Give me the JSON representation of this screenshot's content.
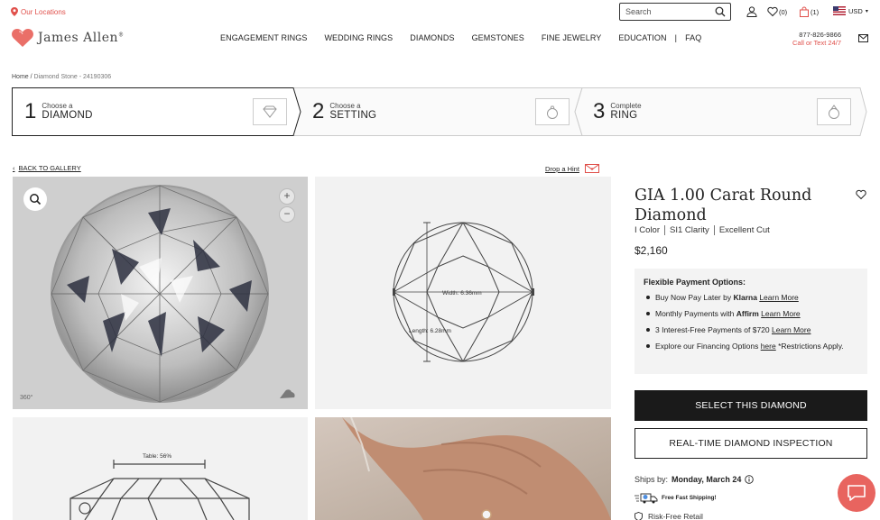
{
  "utility": {
    "location_label": "Our Locations",
    "search_placeholder": "Search",
    "wishlist_count": "(0)",
    "cart_count": "(1)",
    "currency": "USD"
  },
  "header": {
    "logo_text": "James Allen",
    "nav": [
      "ENGAGEMENT RINGS",
      "WEDDING RINGS",
      "DIAMONDS",
      "GEMSTONES",
      "FINE JEWELRY",
      "EDUCATION",
      "FAQ"
    ],
    "phone": "877-826-9866",
    "phone_sub": "Call or Text 24/7"
  },
  "breadcrumb": {
    "home": "Home",
    "current": "Diamond Stone - 24190306"
  },
  "steps": [
    {
      "num": "1",
      "small": "Choose a",
      "big": "DIAMOND",
      "icon": "diamond-icon"
    },
    {
      "num": "2",
      "small": "Choose a",
      "big": "SETTING",
      "icon": "setting-icon"
    },
    {
      "num": "3",
      "small": "Complete",
      "big": "RING",
      "icon": "ring-icon"
    }
  ],
  "gallery": {
    "back_label": "BACK TO GALLERY",
    "hint_label": "Drop a Hint",
    "width_label": "Width: 6.36mm",
    "length_label": "Length: 6.28mm",
    "table_label": "Table: 56%",
    "rotate_label": "360°"
  },
  "product": {
    "title": "GIA 1.00 Carat Round Diamond",
    "specs": [
      "I Color",
      "SI1 Clarity",
      "Excellent Cut"
    ],
    "price": "$2,160"
  },
  "payment": {
    "heading": "Flexible Payment Options:",
    "items": [
      {
        "pre": "Buy Now Pay Later by ",
        "bold": "Klarna",
        "link": "Learn More",
        "post": ""
      },
      {
        "pre": "Monthly Payments with ",
        "bold": "Affirm",
        "link": "Learn More",
        "post": ""
      },
      {
        "pre": "3 Interest-Free Payments of $720 ",
        "bold": "",
        "link": "Learn More",
        "post": ""
      },
      {
        "pre": "Explore our Financing Options ",
        "bold": "",
        "link": "here",
        "post": " *Restrictions Apply."
      }
    ]
  },
  "actions": {
    "select_label": "SELECT THIS DIAMOND",
    "inspect_label": "REAL-TIME DIAMOND INSPECTION"
  },
  "shipping": {
    "ships_by_label": "Ships by:",
    "ships_by_date": "Monday, March 24",
    "free_shipping": "Free Fast Shipping!",
    "risk_free": "Risk-Free Retail"
  },
  "colors": {
    "accent": "#e0504b",
    "dark_button": "#1a1a1a"
  }
}
